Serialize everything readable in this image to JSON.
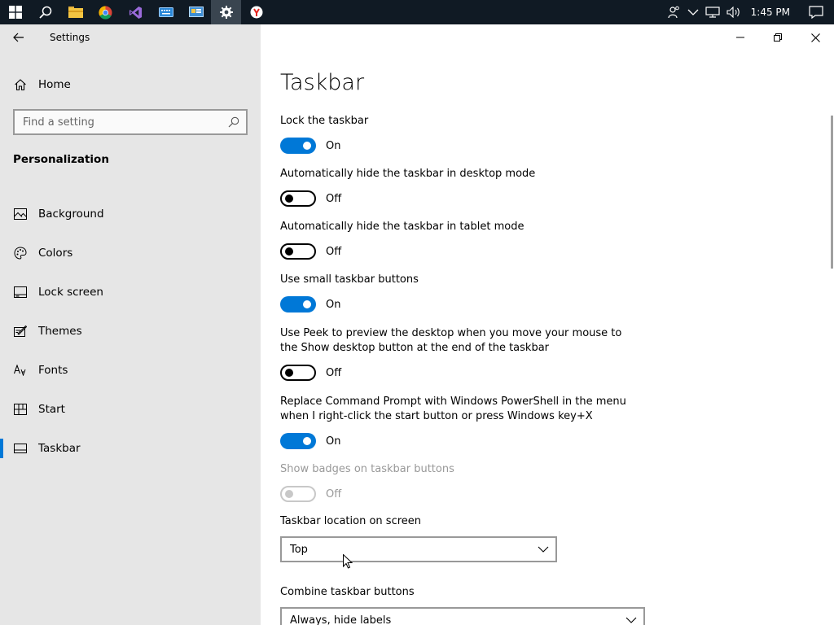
{
  "taskbar": {
    "clock": "1:45 PM",
    "pinned_icons": [
      "windows-start-icon",
      "search-icon",
      "file-explorer-icon",
      "chrome-icon",
      "visual-studio-icon",
      "keyboard-icon",
      "control-panel-icon",
      "settings-gear-icon",
      "yandex-browser-icon"
    ]
  },
  "window": {
    "app_title": "Settings"
  },
  "sidebar": {
    "home_label": "Home",
    "search_placeholder": "Find a setting",
    "section_title": "Personalization",
    "items": [
      {
        "label": "Background",
        "icon": "picture-icon"
      },
      {
        "label": "Colors",
        "icon": "palette-icon"
      },
      {
        "label": "Lock screen",
        "icon": "lock-screen-icon"
      },
      {
        "label": "Themes",
        "icon": "themes-icon"
      },
      {
        "label": "Fonts",
        "icon": "fonts-icon"
      },
      {
        "label": "Start",
        "icon": "start-icon"
      },
      {
        "label": "Taskbar",
        "icon": "taskbar-icon"
      }
    ],
    "selected": "Taskbar"
  },
  "main": {
    "title": "Taskbar",
    "settings": [
      {
        "label": "Lock the taskbar",
        "state": "On"
      },
      {
        "label": "Automatically hide the taskbar in desktop mode",
        "state": "Off"
      },
      {
        "label": "Automatically hide the taskbar in tablet mode",
        "state": "Off"
      },
      {
        "label": "Use small taskbar buttons",
        "state": "On"
      },
      {
        "label": "Use Peek to preview the desktop when you move your mouse to the Show desktop button at the end of the taskbar",
        "state": "Off"
      },
      {
        "label": "Replace Command Prompt with Windows PowerShell in the menu when I right-click the start button or press Windows key+X",
        "state": "On"
      },
      {
        "label": "Show badges on taskbar buttons",
        "state": "Off",
        "disabled": true
      }
    ],
    "location_label": "Taskbar location on screen",
    "location_value": "Top",
    "combine_label": "Combine taskbar buttons",
    "combine_value": "Always, hide labels"
  },
  "colors": {
    "accent": "#0078d7",
    "sidebar_bg": "#e6e6e6",
    "taskbar_bg": "#101a24"
  }
}
